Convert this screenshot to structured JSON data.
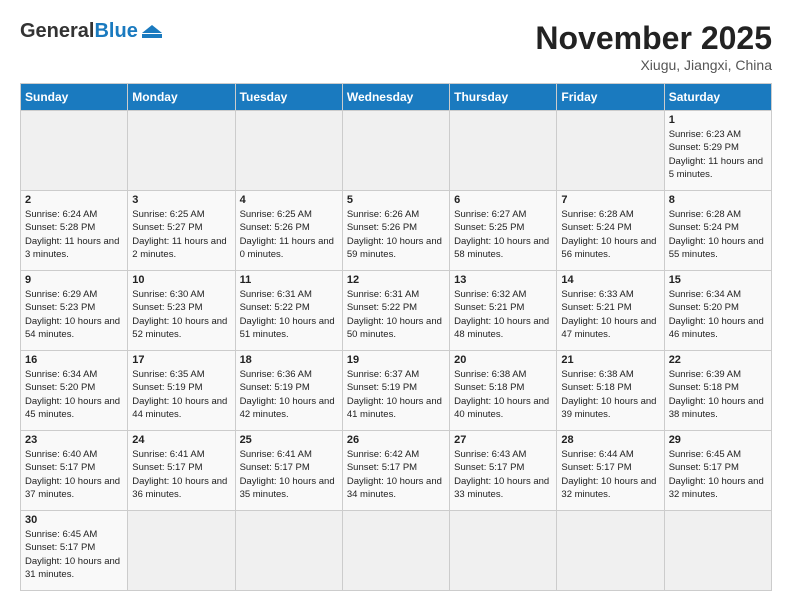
{
  "header": {
    "logo_general": "General",
    "logo_blue": "Blue",
    "title": "November 2025",
    "subtitle": "Xiugu, Jiangxi, China"
  },
  "weekdays": [
    "Sunday",
    "Monday",
    "Tuesday",
    "Wednesday",
    "Thursday",
    "Friday",
    "Saturday"
  ],
  "days": [
    {
      "day": "",
      "sunrise": "",
      "sunset": "",
      "daylight": "",
      "empty": true
    },
    {
      "day": "",
      "sunrise": "",
      "sunset": "",
      "daylight": "",
      "empty": true
    },
    {
      "day": "",
      "sunrise": "",
      "sunset": "",
      "daylight": "",
      "empty": true
    },
    {
      "day": "",
      "sunrise": "",
      "sunset": "",
      "daylight": "",
      "empty": true
    },
    {
      "day": "",
      "sunrise": "",
      "sunset": "",
      "daylight": "",
      "empty": true
    },
    {
      "day": "",
      "sunrise": "",
      "sunset": "",
      "daylight": "",
      "empty": true
    },
    {
      "day": "1",
      "sunrise": "6:23 AM",
      "sunset": "5:29 PM",
      "daylight": "11 hours and 5 minutes.",
      "empty": false
    },
    {
      "day": "2",
      "sunrise": "6:24 AM",
      "sunset": "5:28 PM",
      "daylight": "11 hours and 3 minutes.",
      "empty": false
    },
    {
      "day": "3",
      "sunrise": "6:25 AM",
      "sunset": "5:27 PM",
      "daylight": "11 hours and 2 minutes.",
      "empty": false
    },
    {
      "day": "4",
      "sunrise": "6:25 AM",
      "sunset": "5:26 PM",
      "daylight": "11 hours and 0 minutes.",
      "empty": false
    },
    {
      "day": "5",
      "sunrise": "6:26 AM",
      "sunset": "5:26 PM",
      "daylight": "10 hours and 59 minutes.",
      "empty": false
    },
    {
      "day": "6",
      "sunrise": "6:27 AM",
      "sunset": "5:25 PM",
      "daylight": "10 hours and 58 minutes.",
      "empty": false
    },
    {
      "day": "7",
      "sunrise": "6:28 AM",
      "sunset": "5:24 PM",
      "daylight": "10 hours and 56 minutes.",
      "empty": false
    },
    {
      "day": "8",
      "sunrise": "6:28 AM",
      "sunset": "5:24 PM",
      "daylight": "10 hours and 55 minutes.",
      "empty": false
    },
    {
      "day": "9",
      "sunrise": "6:29 AM",
      "sunset": "5:23 PM",
      "daylight": "10 hours and 54 minutes.",
      "empty": false
    },
    {
      "day": "10",
      "sunrise": "6:30 AM",
      "sunset": "5:23 PM",
      "daylight": "10 hours and 52 minutes.",
      "empty": false
    },
    {
      "day": "11",
      "sunrise": "6:31 AM",
      "sunset": "5:22 PM",
      "daylight": "10 hours and 51 minutes.",
      "empty": false
    },
    {
      "day": "12",
      "sunrise": "6:31 AM",
      "sunset": "5:22 PM",
      "daylight": "10 hours and 50 minutes.",
      "empty": false
    },
    {
      "day": "13",
      "sunrise": "6:32 AM",
      "sunset": "5:21 PM",
      "daylight": "10 hours and 48 minutes.",
      "empty": false
    },
    {
      "day": "14",
      "sunrise": "6:33 AM",
      "sunset": "5:21 PM",
      "daylight": "10 hours and 47 minutes.",
      "empty": false
    },
    {
      "day": "15",
      "sunrise": "6:34 AM",
      "sunset": "5:20 PM",
      "daylight": "10 hours and 46 minutes.",
      "empty": false
    },
    {
      "day": "16",
      "sunrise": "6:34 AM",
      "sunset": "5:20 PM",
      "daylight": "10 hours and 45 minutes.",
      "empty": false
    },
    {
      "day": "17",
      "sunrise": "6:35 AM",
      "sunset": "5:19 PM",
      "daylight": "10 hours and 44 minutes.",
      "empty": false
    },
    {
      "day": "18",
      "sunrise": "6:36 AM",
      "sunset": "5:19 PM",
      "daylight": "10 hours and 42 minutes.",
      "empty": false
    },
    {
      "day": "19",
      "sunrise": "6:37 AM",
      "sunset": "5:19 PM",
      "daylight": "10 hours and 41 minutes.",
      "empty": false
    },
    {
      "day": "20",
      "sunrise": "6:38 AM",
      "sunset": "5:18 PM",
      "daylight": "10 hours and 40 minutes.",
      "empty": false
    },
    {
      "day": "21",
      "sunrise": "6:38 AM",
      "sunset": "5:18 PM",
      "daylight": "10 hours and 39 minutes.",
      "empty": false
    },
    {
      "day": "22",
      "sunrise": "6:39 AM",
      "sunset": "5:18 PM",
      "daylight": "10 hours and 38 minutes.",
      "empty": false
    },
    {
      "day": "23",
      "sunrise": "6:40 AM",
      "sunset": "5:17 PM",
      "daylight": "10 hours and 37 minutes.",
      "empty": false
    },
    {
      "day": "24",
      "sunrise": "6:41 AM",
      "sunset": "5:17 PM",
      "daylight": "10 hours and 36 minutes.",
      "empty": false
    },
    {
      "day": "25",
      "sunrise": "6:41 AM",
      "sunset": "5:17 PM",
      "daylight": "10 hours and 35 minutes.",
      "empty": false
    },
    {
      "day": "26",
      "sunrise": "6:42 AM",
      "sunset": "5:17 PM",
      "daylight": "10 hours and 34 minutes.",
      "empty": false
    },
    {
      "day": "27",
      "sunrise": "6:43 AM",
      "sunset": "5:17 PM",
      "daylight": "10 hours and 33 minutes.",
      "empty": false
    },
    {
      "day": "28",
      "sunrise": "6:44 AM",
      "sunset": "5:17 PM",
      "daylight": "10 hours and 32 minutes.",
      "empty": false
    },
    {
      "day": "29",
      "sunrise": "6:45 AM",
      "sunset": "5:17 PM",
      "daylight": "10 hours and 32 minutes.",
      "empty": false
    },
    {
      "day": "30",
      "sunrise": "6:45 AM",
      "sunset": "5:17 PM",
      "daylight": "10 hours and 31 minutes.",
      "empty": false
    }
  ],
  "labels": {
    "sunrise_prefix": "Sunrise: ",
    "sunset_prefix": "Sunset: ",
    "daylight_prefix": "Daylight: "
  }
}
